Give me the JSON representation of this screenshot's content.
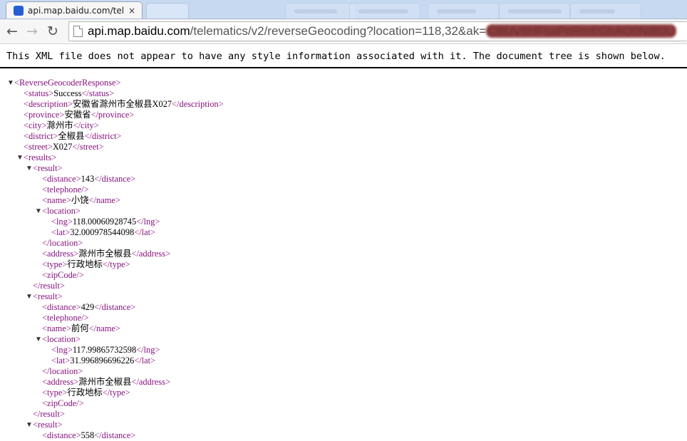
{
  "browser": {
    "active_tab": {
      "title": "api.map.baidu.com/tele",
      "close": "×",
      "favicon": "🐾"
    },
    "nav": {
      "back": "←",
      "forward": "→",
      "reload": "↻"
    },
    "url": {
      "host": "api.map.baidu.com",
      "path": "/telematics/v2/reverseGeocoding?location=118,32&ak=",
      "key": "CBUV6HFsaPoRmEGhAO0NIB0U"
    }
  },
  "notice": "This XML file does not appear to have any style information associated with it. The document tree is shown below.",
  "xml": {
    "root_open": "<ReverseGeocoderResponse>",
    "status_open": "<status>",
    "status": "Success",
    "status_close": "</status>",
    "desc_open": "<description>",
    "description": "安徽省滁州市全椒县X027",
    "desc_close": "</description>",
    "prov_open": "<province>",
    "province": "安徽省",
    "prov_close": "</province>",
    "city_open": "<city>",
    "city": "滁州市",
    "city_close": "</city>",
    "dist_open": "<district>",
    "district": "全椒县",
    "dist_close": "</district>",
    "street_open": "<street>",
    "street": "X027",
    "street_close": "</street>",
    "results_open": "<results>",
    "result_open": "<result>",
    "result_close": "</result>",
    "distance_open": "<distance>",
    "distance_close": "</distance>",
    "telephone": "<telephone/>",
    "name_open": "<name>",
    "name_close": "</name>",
    "location_open": "<location>",
    "location_close": "</location>",
    "lng_open": "<lng>",
    "lng_close": "</lng>",
    "lat_open": "<lat>",
    "lat_close": "</lat>",
    "address_open": "<address>",
    "address_close": "</address>",
    "type_open": "<type>",
    "type_close": "</type>",
    "zipcode": "<zipCode/>",
    "results": [
      {
        "distance": "143",
        "name": "小饶",
        "lng": "118.00060928745",
        "lat": "32.000978544098",
        "address": "滁州市全椒县",
        "type": "行政地标"
      },
      {
        "distance": "429",
        "name": "前何",
        "lng": "117.99865732598",
        "lat": "31.996896696226",
        "address": "滁州市全椒县",
        "type": "行政地标"
      },
      {
        "distance": "558"
      }
    ]
  },
  "colors": {
    "tag": "#881280",
    "tabstrip": "#c7d9f1"
  }
}
